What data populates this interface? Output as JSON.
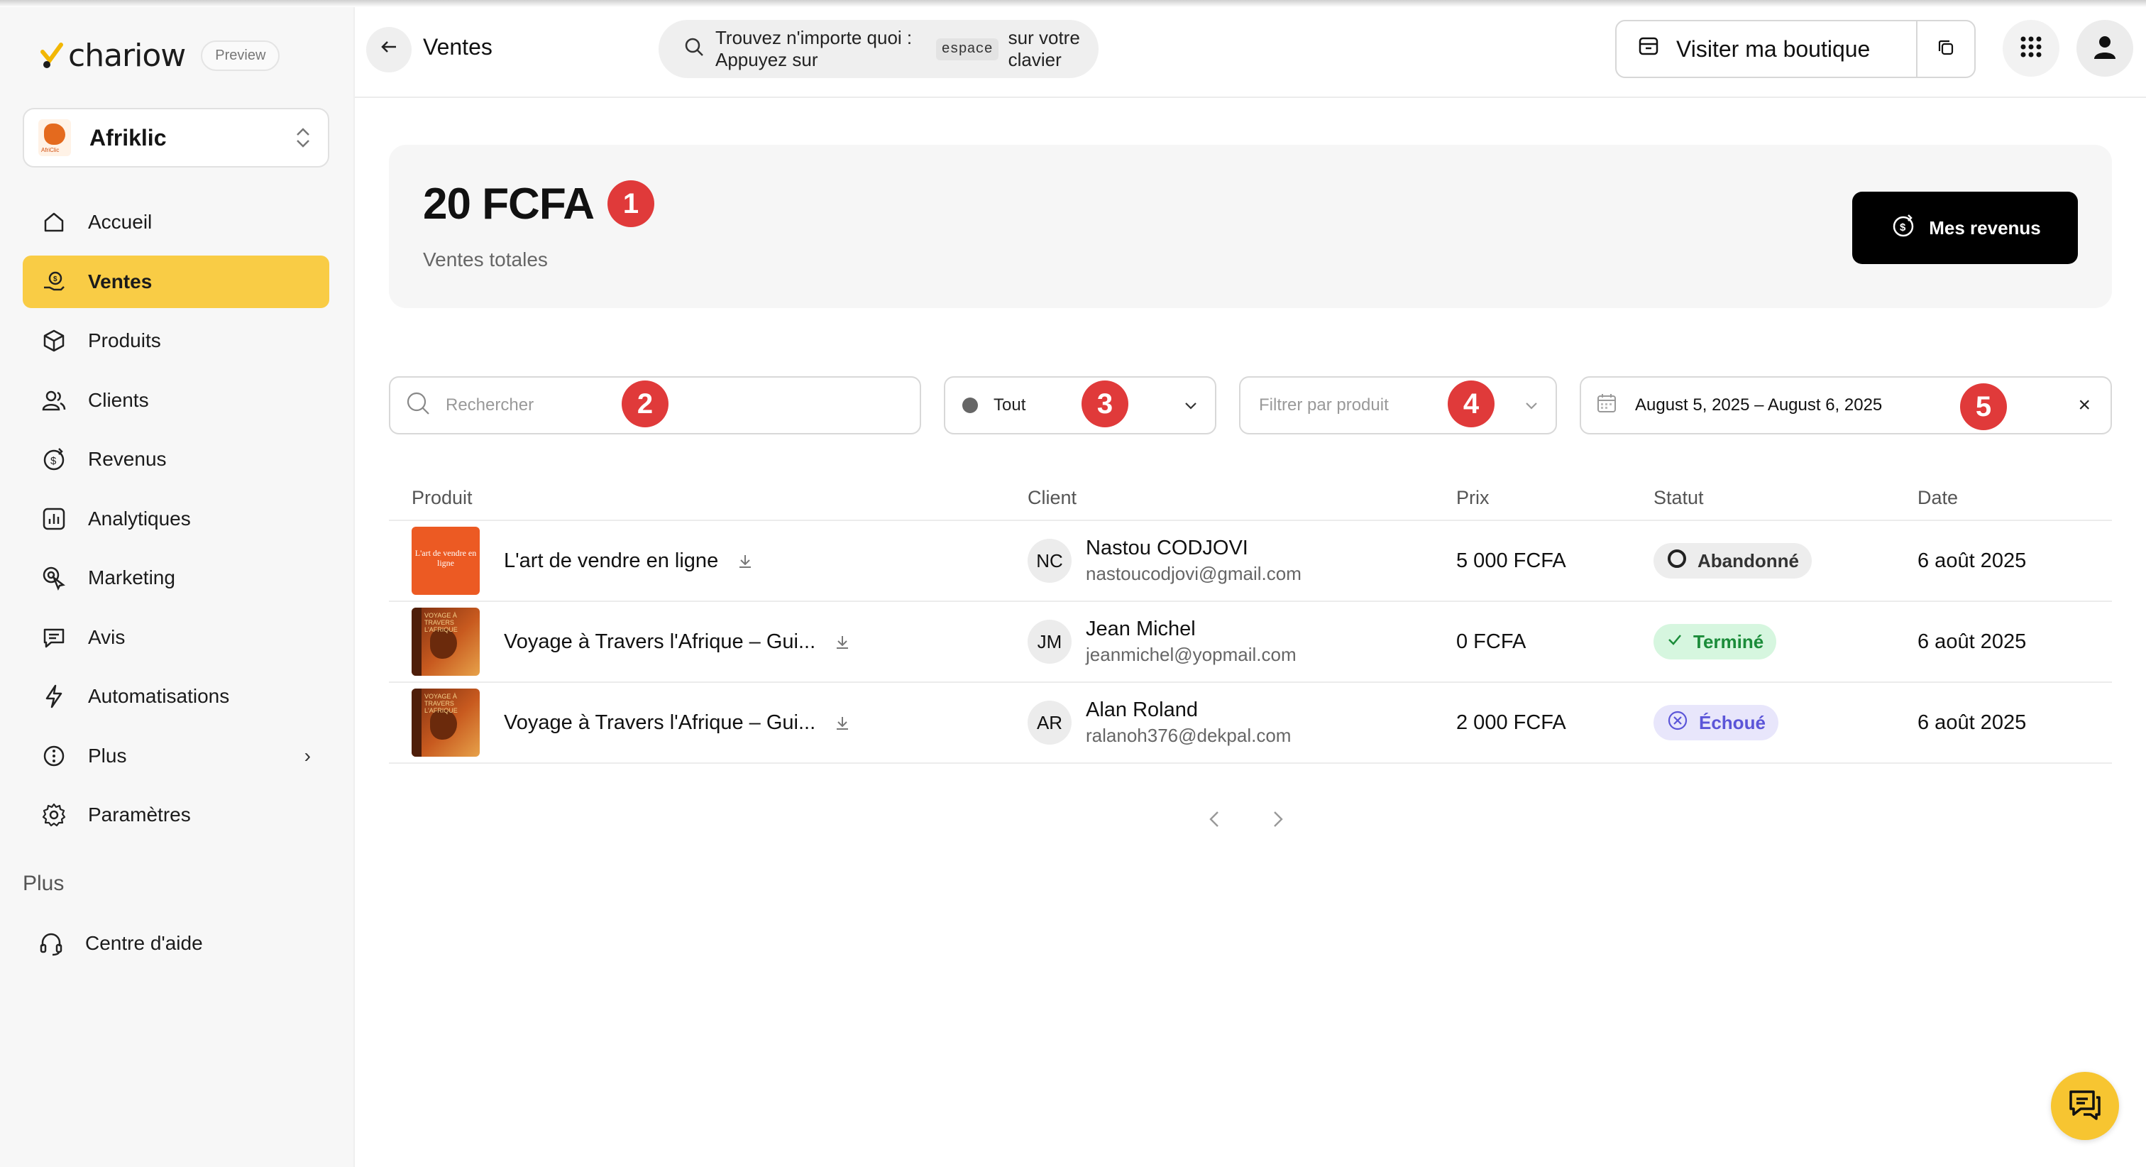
{
  "brand": {
    "name": "chariow",
    "badge": "Preview"
  },
  "shop": {
    "name": "Afriklic",
    "logo_caption": "AfriClic"
  },
  "sidebar": {
    "items": [
      {
        "label": "Accueil",
        "icon": "home-icon",
        "active": false
      },
      {
        "label": "Ventes",
        "icon": "sales-icon",
        "active": true
      },
      {
        "label": "Produits",
        "icon": "box-icon",
        "active": false
      },
      {
        "label": "Clients",
        "icon": "users-icon",
        "active": false
      },
      {
        "label": "Revenus",
        "icon": "revenue-icon",
        "active": false
      },
      {
        "label": "Analytiques",
        "icon": "analytics-icon",
        "active": false
      },
      {
        "label": "Marketing",
        "icon": "marketing-icon",
        "active": false
      },
      {
        "label": "Avis",
        "icon": "reviews-icon",
        "active": false
      },
      {
        "label": "Automatisations",
        "icon": "bolt-icon",
        "active": false
      },
      {
        "label": "Plus",
        "icon": "more-icon",
        "active": false,
        "has_chevron": true
      },
      {
        "label": "Paramètres",
        "icon": "gear-icon",
        "active": false
      }
    ],
    "section_label": "Plus",
    "help_label": "Centre d'aide"
  },
  "header": {
    "title": "Ventes",
    "search_prefix": "Trouvez n'importe quoi : Appuyez sur",
    "search_key": "espace",
    "search_suffix": "sur votre clavier",
    "visit_label": "Visiter ma boutique"
  },
  "summary": {
    "amount": "20 FCFA",
    "label": "Ventes totales",
    "revenue_button": "Mes revenus"
  },
  "filters": {
    "search_placeholder": "Rechercher",
    "status_value": "Tout",
    "product_placeholder": "Filtrer par produit",
    "date_range": "August 5, 2025 – August 6, 2025",
    "clear": "×"
  },
  "markers": [
    "1",
    "2",
    "3",
    "4",
    "5"
  ],
  "table": {
    "headers": {
      "product": "Produit",
      "client": "Client",
      "price": "Prix",
      "status": "Statut",
      "date": "Date"
    },
    "rows": [
      {
        "product": "L'art de vendre en ligne",
        "thumb_text": "L'art de vendre en ligne",
        "initials": "NC",
        "client": "Nastou CODJOVI",
        "email": "nastoucodjovi@gmail.com",
        "price": "5 000 FCFA",
        "status": "Abandonné",
        "date": "6 août 2025"
      },
      {
        "product": "Voyage à Travers l'Afrique – Gui...",
        "thumb_text": "VOYAGE À TRAVERS L'AFRIQUE",
        "initials": "JM",
        "client": "Jean Michel",
        "email": "jeanmichel@yopmail.com",
        "price": "0 FCFA",
        "status": "Terminé",
        "date": "6 août 2025"
      },
      {
        "product": "Voyage à Travers l'Afrique – Gui...",
        "thumb_text": "VOYAGE À TRAVERS L'AFRIQUE",
        "initials": "AR",
        "client": "Alan Roland",
        "email": "ralanoh376@dekpal.com",
        "price": "2 000 FCFA",
        "status": "Échoué",
        "date": "6 août 2025"
      }
    ]
  },
  "colors": {
    "accent": "#f9cc45",
    "marker": "#e03a3a",
    "success": "#1b8c3a",
    "failed": "#5b55d8"
  }
}
